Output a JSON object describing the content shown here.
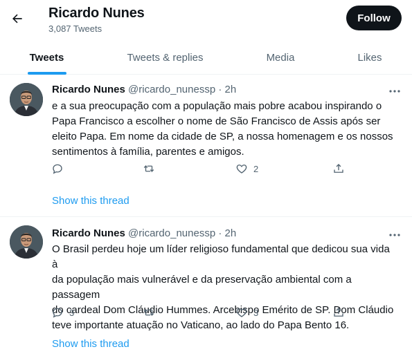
{
  "header": {
    "title": "Ricardo Nunes",
    "tweet_count": "3,087 Tweets",
    "follow_label": "Follow",
    "back_icon": "arrow-left-icon"
  },
  "tabs": [
    {
      "label": "Tweets",
      "active": true
    },
    {
      "label": "Tweets & replies",
      "active": false
    },
    {
      "label": "Media",
      "active": false
    },
    {
      "label": "Likes",
      "active": false
    }
  ],
  "tweets": [
    {
      "name": "Ricardo Nunes",
      "handle": "@ricardo_nunessp",
      "separator": "·",
      "time": "2h",
      "lines": [
        "e a sua preocupação com a população mais pobre acabou inspirando o",
        "Papa Francisco a escolher o nome de São Francisco de Assis após ser",
        "eleito Papa. Em nome da cidade de SP, a nossa homenagem e os nossos",
        "sentimentos à família, parentes e amigos."
      ],
      "replies": "",
      "retweets": "",
      "likes": "2",
      "thread_link": "Show this thread"
    },
    {
      "name": "Ricardo Nunes",
      "handle": "@ricardo_nunessp",
      "separator": "·",
      "time": "2h",
      "lines": [
        "O Brasil perdeu hoje um líder religioso fundamental que dedicou sua vida à",
        "da população mais vulnerável e da preservação ambiental com a passagem",
        "do cardeal Dom Cláudio Hummes. Arcebispo Emérito de SP. Dom Cláudio",
        "teve importante atuação no Vaticano, ao lado do Papa Bento 16."
      ],
      "replies": "3",
      "retweets": "",
      "likes": "3",
      "thread_link": "Show this thread"
    }
  ],
  "colors": {
    "accent": "#1d9bf0",
    "text_primary": "#0f1419",
    "text_secondary": "#536471",
    "divider": "#eff3f4"
  }
}
